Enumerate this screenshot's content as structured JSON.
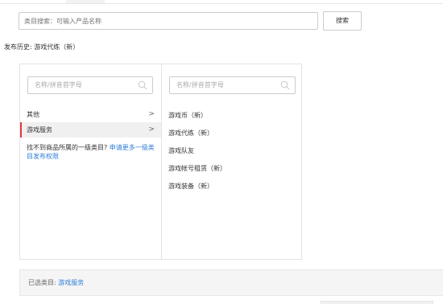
{
  "search": {
    "placeholder": "类目搜索：可输入产品名称",
    "button_label": "搜索"
  },
  "history": {
    "text": "发布历史: 游戏代练（新）"
  },
  "left_column": {
    "filter_placeholder": "名称/拼音首字母",
    "items": [
      {
        "label": "其他",
        "chevron": ">"
      },
      {
        "label": "游戏服务",
        "chevron": ">"
      }
    ],
    "notice_text": "找不到商品所属的一级类目?",
    "notice_link": "申请更多一级类目发布权限"
  },
  "right_column": {
    "filter_placeholder": "名称/拼音首字母",
    "items": [
      {
        "label": "游戏币（新）"
      },
      {
        "label": "游戏代练（新）"
      },
      {
        "label": "游戏队友"
      },
      {
        "label": "游戏帐号租赁（新）"
      },
      {
        "label": "游戏装备（新）"
      }
    ]
  },
  "footer": {
    "label": "已选类目:",
    "value": "游戏服务"
  },
  "colors": {
    "accent_link": "#2f7ed8",
    "selected_marker": "#e4393c"
  },
  "icons": {
    "filter_search": "search-icon",
    "expand": "chevron-right-icon"
  }
}
